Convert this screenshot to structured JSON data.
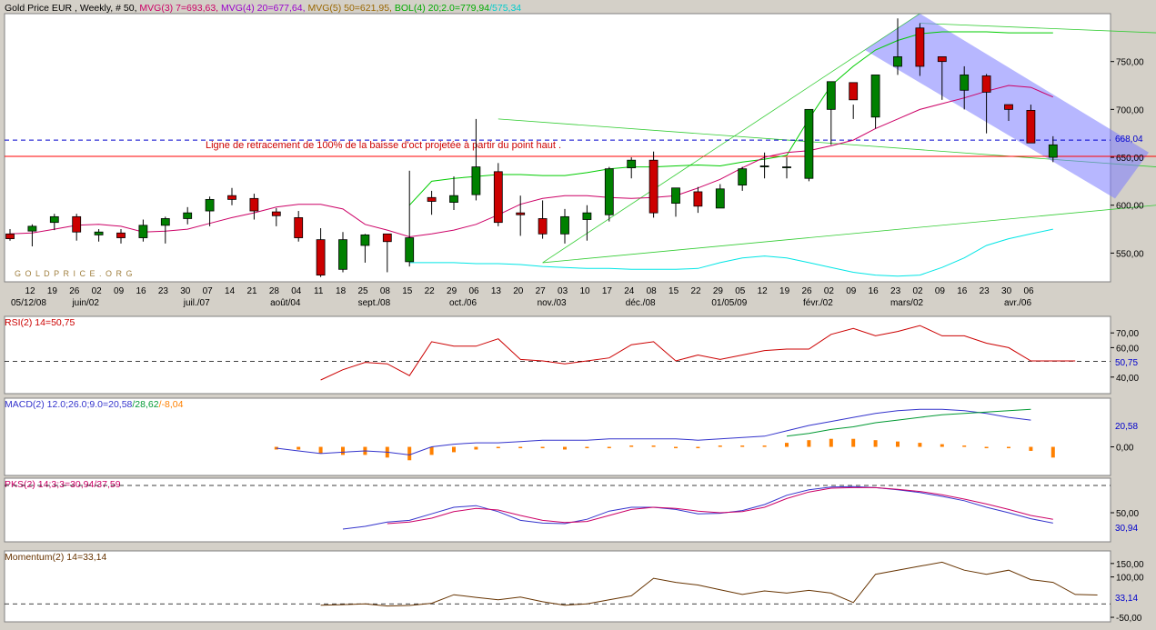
{
  "colors": {
    "background": "#ffffff",
    "frame": "#d4d0c8",
    "up_candle": "#008000",
    "down_candle": "#cc0000",
    "mvg3": "#cc0066",
    "mvg4": "#6600cc",
    "mvg5": "#cc0066",
    "bol_upper": "#00cc00",
    "bol_lower": "#00e5e5",
    "trendline": "#33cc33",
    "channel": "#7b7bff",
    "retrace_line": "#ff0000",
    "retrace_dash": "#0000cc",
    "rsi": "#cc0000",
    "macd": "#3333cc",
    "signal": "#009933",
    "hist": "#ff8000",
    "pks_k": "#3333cc",
    "pks_d": "#cc0066",
    "momentum": "#663300",
    "label_blue": "#0000cc",
    "label_red": "#cc0000"
  },
  "price_panel": {
    "header": [
      {
        "text": "Gold Price EUR , Weekly, # 50, ",
        "color": "#000000"
      },
      {
        "text": "MVG(3) 7=693,63, ",
        "color": "#cc0066"
      },
      {
        "text": "MVG(4) 20=677,64, ",
        "color": "#9900cc"
      },
      {
        "text": "MVG(5) 50=621,95, ",
        "color": "#996600"
      },
      {
        "text": "BOL(4) 20;2.0=779,94",
        "color": "#00aa00"
      },
      {
        "text": "/575,34",
        "color": "#00cccc"
      }
    ],
    "watermark": "G O L D P R I C E . O R G",
    "annotation": "Ligne de retracement de 100% de la baisse d'oct projetée  à partir du point haut .",
    "y_ticks": [
      "750,00",
      "700,00",
      "650,00",
      "600,00",
      "550,00"
    ],
    "last_value": "668,04"
  },
  "x_axis": {
    "day_labels": [
      "12",
      "19",
      "26",
      "02",
      "09",
      "16",
      "23",
      "30",
      "07",
      "14",
      "21",
      "28",
      "04",
      "11",
      "18",
      "25",
      "08",
      "15",
      "22",
      "29",
      "06",
      "13",
      "20",
      "27",
      "03",
      "10",
      "17",
      "24",
      "08",
      "15",
      "22",
      "29",
      "05",
      "12",
      "19",
      "26",
      "02",
      "09",
      "16",
      "23",
      "02",
      "09",
      "16",
      "23",
      "30",
      "06"
    ],
    "month_labels": [
      "05/12/08",
      "juin/02",
      "juil./07",
      "août/04",
      "sept./08",
      "oct./06",
      "nov./03",
      "déc./08",
      "01/05/09",
      "févr./02",
      "mars/02",
      "avr./06"
    ]
  },
  "rsi_panel": {
    "label": "RSI(2) 14=50,75",
    "y_ticks": [
      "70,00",
      "60,00",
      "40,00"
    ],
    "last_value": "50,75"
  },
  "macd_panel": {
    "label_parts": [
      {
        "text": "MACD(2) 12.0;26.0;9.0=20,58",
        "color": "#3333cc"
      },
      {
        "text": "/28,62",
        "color": "#009933"
      },
      {
        "text": "/-8,04",
        "color": "#ff8000"
      }
    ],
    "y_ticks": [
      "0,00"
    ],
    "last_value": "20,58"
  },
  "pks_panel": {
    "label": "PKS(2) 14;3;3=30,94/37,59",
    "y_ticks": [
      "50,00"
    ],
    "last_value": "30,94"
  },
  "momentum_panel": {
    "label": "Momentum(2) 14=33,14",
    "y_ticks": [
      "150,00",
      "100,00",
      "-50,00"
    ],
    "last_value": "33,14"
  },
  "chart_data": [
    {
      "type": "candlestick",
      "title": "Gold Price EUR , Weekly, # 50",
      "categories": [
        "12",
        "19",
        "26",
        "02",
        "09",
        "16",
        "23",
        "30",
        "07",
        "14",
        "21",
        "28",
        "04",
        "11",
        "18",
        "25",
        "08",
        "15",
        "22",
        "29",
        "06",
        "13",
        "20",
        "27",
        "03",
        "10",
        "17",
        "24",
        "08",
        "15",
        "22",
        "29",
        "05",
        "12",
        "19",
        "26",
        "02",
        "09",
        "16",
        "23",
        "02",
        "09",
        "16",
        "23",
        "30",
        "06"
      ],
      "ylim": [
        520,
        800
      ],
      "ohlc": [
        [
          570,
          575,
          563,
          565
        ],
        [
          573,
          580,
          557,
          578
        ],
        [
          582,
          591,
          574,
          588
        ],
        [
          588,
          591,
          563,
          572
        ],
        [
          569,
          575,
          562,
          572
        ],
        [
          571,
          575,
          560,
          566
        ],
        [
          566,
          585,
          562,
          579
        ],
        [
          579,
          588,
          560,
          586
        ],
        [
          586,
          598,
          580,
          592
        ],
        [
          594,
          609,
          578,
          606
        ],
        [
          610,
          618,
          600,
          606
        ],
        [
          607,
          612,
          585,
          594
        ],
        [
          593,
          597,
          578,
          589
        ],
        [
          587,
          594,
          562,
          566
        ],
        [
          564,
          576,
          525,
          527
        ],
        [
          533,
          572,
          530,
          564
        ],
        [
          558,
          570,
          540,
          569
        ],
        [
          570,
          570,
          530,
          562
        ],
        [
          541,
          636,
          536,
          566
        ],
        [
          608,
          615,
          590,
          604
        ],
        [
          603,
          630,
          595,
          610
        ],
        [
          611,
          690,
          605,
          640
        ],
        [
          635,
          644,
          578,
          582
        ],
        [
          592,
          610,
          568,
          590
        ],
        [
          586,
          605,
          565,
          570
        ],
        [
          570,
          596,
          560,
          588
        ],
        [
          585,
          600,
          563,
          592
        ],
        [
          590,
          640,
          583,
          638
        ],
        [
          639,
          650,
          628,
          647
        ],
        [
          647,
          656,
          587,
          592
        ],
        [
          602,
          610,
          588,
          618
        ],
        [
          614,
          619,
          592,
          599
        ],
        [
          597,
          622,
          600,
          617
        ],
        [
          621,
          640,
          615,
          638
        ],
        [
          640,
          655,
          628,
          641
        ],
        [
          640,
          650,
          628,
          640
        ],
        [
          628,
          692,
          625,
          700
        ],
        [
          700,
          725,
          663,
          729
        ],
        [
          728,
          705,
          690,
          710
        ],
        [
          692,
          735,
          680,
          736
        ],
        [
          745,
          795,
          736,
          755
        ],
        [
          785,
          790,
          735,
          745
        ],
        [
          755,
          755,
          710,
          750
        ],
        [
          720,
          745,
          700,
          736
        ],
        [
          735,
          737,
          675,
          718
        ],
        [
          705,
          705,
          688,
          700
        ],
        [
          699,
          705,
          675,
          665
        ],
        [
          650,
          672,
          645,
          663
        ]
      ],
      "overlays": {
        "mvg3": [
          570,
          571,
          575,
          579,
          580,
          578,
          572,
          573,
          575,
          581,
          587,
          592,
          598,
          601,
          601,
          596,
          580,
          574,
          567,
          570,
          574,
          580,
          590,
          601,
          607,
          610,
          610,
          608,
          607,
          608,
          610,
          618,
          627,
          639,
          650,
          655,
          657,
          662,
          668,
          680,
          690,
          700,
          706,
          712,
          719,
          725,
          723,
          713
        ],
        "bollinger_upper": [
          null,
          null,
          null,
          null,
          null,
          null,
          null,
          null,
          null,
          null,
          null,
          null,
          null,
          null,
          null,
          null,
          null,
          null,
          600,
          625,
          628,
          630,
          632,
          632,
          631,
          631,
          634,
          638,
          640,
          640,
          641,
          642,
          641,
          645,
          648,
          652,
          690,
          725,
          745,
          762,
          772,
          779,
          781,
          781,
          781,
          780,
          780,
          780
        ],
        "bollinger_lower": [
          null,
          null,
          null,
          null,
          null,
          null,
          null,
          null,
          null,
          null,
          null,
          null,
          null,
          null,
          null,
          null,
          null,
          null,
          540,
          540,
          540,
          539,
          539,
          538,
          536,
          535,
          534,
          534,
          533,
          533,
          533,
          534,
          540,
          545,
          547,
          545,
          540,
          535,
          530,
          527,
          526,
          527,
          535,
          545,
          558,
          565,
          570,
          575
        ]
      }
    },
    {
      "type": "line",
      "title": "RSI(2) 14=50,75",
      "ylim": [
        30,
        80
      ],
      "series": [
        {
          "name": "RSI",
          "values": [
            null,
            null,
            null,
            null,
            null,
            null,
            null,
            null,
            null,
            null,
            null,
            null,
            null,
            null,
            38,
            45,
            50,
            49,
            41,
            64,
            61,
            61,
            66,
            52,
            51,
            49,
            51,
            53,
            62,
            64,
            51,
            55,
            52,
            55,
            58,
            59,
            59,
            69,
            73,
            68,
            71,
            75,
            68,
            68,
            63,
            60,
            51,
            51,
            51
          ]
        }
      ]
    },
    {
      "type": "line",
      "title": "MACD(2) 12.0;26.0;9.0",
      "ylim": [
        -20,
        35
      ],
      "series": [
        {
          "name": "MACD",
          "values": [
            null,
            null,
            null,
            null,
            null,
            null,
            null,
            null,
            null,
            null,
            null,
            null,
            -1,
            -3,
            -5,
            -4,
            -3,
            -4,
            -6,
            0,
            2,
            3,
            3,
            4,
            5,
            5,
            5,
            6,
            6,
            6,
            6,
            5,
            6,
            7,
            8,
            12,
            16,
            19,
            22,
            25,
            27,
            28,
            28,
            27,
            25,
            22,
            20
          ]
        },
        {
          "name": "Signal",
          "values": [
            null,
            null,
            null,
            null,
            null,
            null,
            null,
            null,
            null,
            null,
            null,
            null,
            null,
            null,
            null,
            null,
            null,
            null,
            null,
            null,
            null,
            null,
            null,
            null,
            null,
            null,
            null,
            null,
            null,
            null,
            null,
            null,
            null,
            null,
            null,
            8,
            10,
            13,
            15,
            18,
            20,
            22,
            24,
            25,
            26,
            27,
            28
          ]
        },
        {
          "name": "Histogram",
          "values": [
            null,
            null,
            null,
            null,
            null,
            null,
            null,
            null,
            null,
            null,
            null,
            null,
            -2,
            -2,
            -5,
            -6,
            -6,
            -8,
            -10,
            -6,
            -4,
            -2,
            -1,
            -1,
            -1,
            -2,
            -1,
            0,
            1,
            1,
            0,
            0,
            1,
            1,
            1,
            3,
            5,
            6,
            6,
            5,
            4,
            3,
            2,
            1,
            0,
            -1,
            -3,
            -8
          ]
        }
      ]
    },
    {
      "type": "line",
      "title": "PKS(2) 14;3;3",
      "ylim": [
        0,
        110
      ],
      "series": [
        {
          "name": "K",
          "values": [
            null,
            null,
            null,
            null,
            null,
            null,
            null,
            null,
            null,
            null,
            null,
            null,
            null,
            null,
            null,
            20,
            25,
            33,
            36,
            48,
            60,
            63,
            52,
            36,
            31,
            30,
            38,
            53,
            60,
            60,
            56,
            48,
            49,
            54,
            65,
            82,
            92,
            97,
            98,
            96,
            92,
            87,
            80,
            72,
            60,
            50,
            39,
            31
          ]
        },
        {
          "name": "D",
          "values": [
            null,
            null,
            null,
            null,
            null,
            null,
            null,
            null,
            null,
            null,
            null,
            null,
            null,
            null,
            null,
            null,
            null,
            30,
            33,
            40,
            52,
            58,
            55,
            45,
            36,
            32,
            34,
            45,
            56,
            60,
            58,
            53,
            50,
            52,
            60,
            76,
            88,
            95,
            96,
            96,
            93,
            89,
            83,
            75,
            66,
            56,
            45,
            38
          ]
        }
      ]
    },
    {
      "type": "line",
      "title": "Momentum(2) 14=33,14",
      "ylim": [
        -60,
        190
      ],
      "series": [
        {
          "name": "Momentum",
          "values": [
            null,
            null,
            null,
            null,
            null,
            null,
            null,
            null,
            null,
            null,
            null,
            null,
            null,
            null,
            -5,
            -3,
            0,
            -8,
            -6,
            2,
            34,
            24,
            15,
            25,
            8,
            -5,
            0,
            15,
            30,
            95,
            80,
            70,
            52,
            35,
            48,
            40,
            50,
            40,
            5,
            110,
            125,
            140,
            155,
            125,
            110,
            125,
            90,
            80,
            35,
            33
          ]
        }
      ]
    }
  ]
}
